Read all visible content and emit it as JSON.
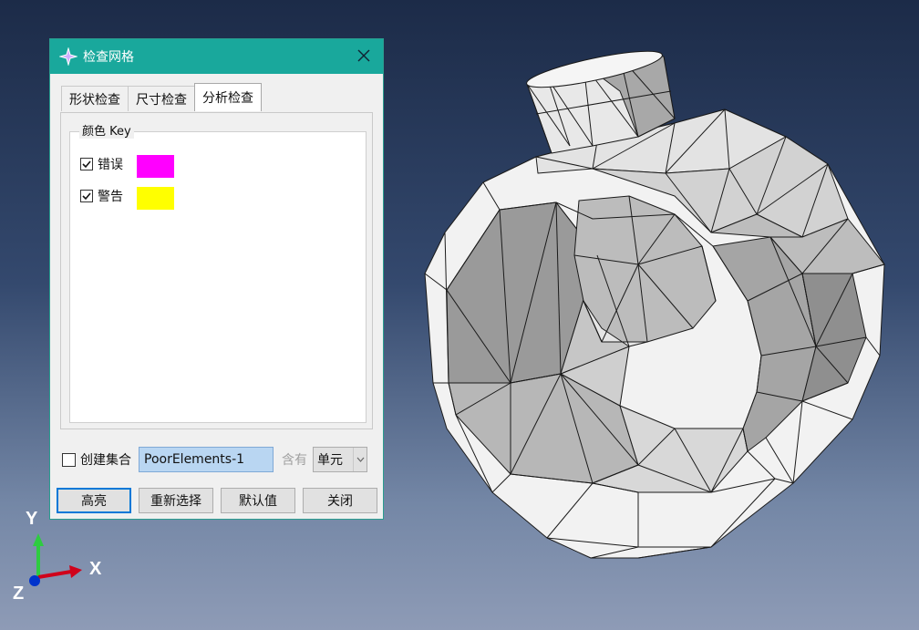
{
  "dialog": {
    "title": "检查网格",
    "tabs": [
      {
        "label": "形状检查",
        "active": false
      },
      {
        "label": "尺寸检查",
        "active": false
      },
      {
        "label": "分析检查",
        "active": true
      }
    ],
    "color_key": {
      "legend": "颜色 Key",
      "items": [
        {
          "label": "错误",
          "checked": true,
          "color": "#ff00ff"
        },
        {
          "label": "警告",
          "checked": true,
          "color": "#ffff00"
        }
      ]
    },
    "create_set": {
      "label": "创建集合",
      "checked": false,
      "value": "PoorElements-1",
      "contains_label": "含有",
      "select_value": "单元"
    },
    "buttons": {
      "highlight": "高亮",
      "reselect": "重新选择",
      "defaults": "默认值",
      "close": "关闭"
    }
  },
  "triad": {
    "x_label": "X",
    "y_label": "Y",
    "z_label": "Z",
    "x_color": "#d0021b",
    "y_color": "#2ecc40",
    "z_color": "#0033cc"
  }
}
